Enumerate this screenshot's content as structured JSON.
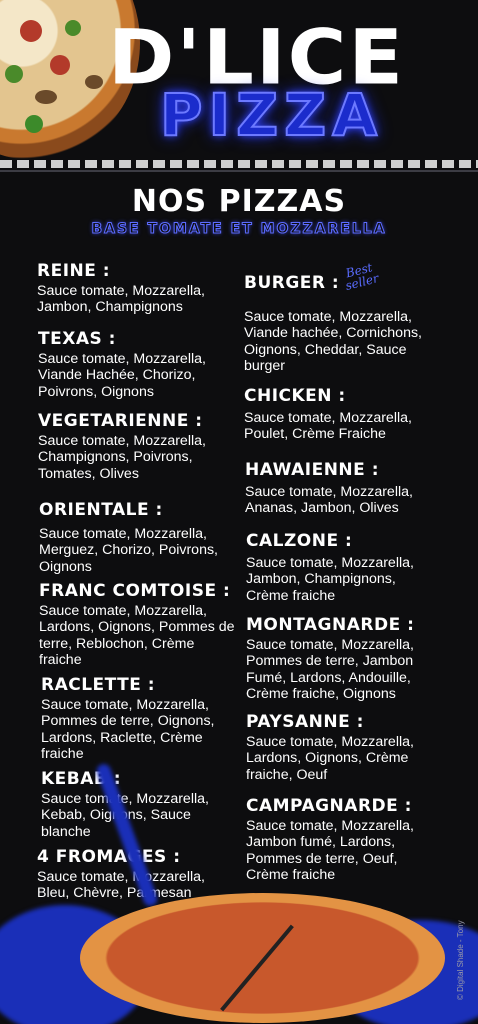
{
  "brand": {
    "name": "D'LICE",
    "subname": "PIZZA"
  },
  "menu": {
    "title": "NOS PIZZAS",
    "subtitle": "BASE TOMATE ET MOZZARELLA",
    "left": [
      {
        "name": "REINE :",
        "desc": "Sauce tomate, Mozzarella, Jambon, Champignons"
      },
      {
        "name": "TEXAS :",
        "desc": "Sauce tomate, Mozzarella, Viande Hachée, Chorizo, Poivrons, Oignons"
      },
      {
        "name": "VEGETARIENNE :",
        "desc": "Sauce tomate, Mozzarella, Champignons, Poivrons, Tomates, Olives"
      },
      {
        "name": "ORIENTALE :",
        "desc": "Sauce tomate, Mozzarella, Merguez, Chorizo, Poivrons, Oignons"
      },
      {
        "name": "FRANC COMTOISE :",
        "desc": "Sauce tomate, Mozzarella, Lardons, Oignons, Pommes de terre, Reblochon, Crème fraiche"
      },
      {
        "name": "RACLETTE :",
        "desc": "Sauce tomate, Mozzarella, Pommes de terre, Oignons, Lardons, Raclette, Crème fraiche"
      },
      {
        "name": "KEBAB :",
        "desc": "Sauce tomate, Mozzarella, Kebab, Oignons, Sauce blanche"
      },
      {
        "name": "4 FROMAGES :",
        "desc": "Sauce tomate, Mozzarella, Bleu, Chèvre, Parmesan"
      }
    ],
    "right": [
      {
        "name": "BURGER :",
        "desc": "Sauce tomate, Mozzarella, Viande hachée, Cornichons, Oignons, Cheddar, Sauce burger"
      },
      {
        "name": "CHICKEN :",
        "desc": "Sauce tomate, Mozzarella, Poulet, Crème Fraiche"
      },
      {
        "name": "HAWAIENNE :",
        "desc": "Sauce tomate, Mozzarella, Ananas, Jambon, Olives"
      },
      {
        "name": "CALZONE :",
        "desc": "Sauce tomate, Mozzarella, Jambon, Champignons, Crème fraiche"
      },
      {
        "name": "MONTAGNARDE :",
        "desc": "Sauce tomate, Mozzarella, Pommes de terre, Jambon Fumé, Lardons, Andouille, Crème fraiche, Oignons"
      },
      {
        "name": "PAYSANNE :",
        "desc": "Sauce tomate, Mozzarella, Lardons, Oignons, Crème fraiche, Oeuf"
      },
      {
        "name": "CAMPAGNARDE :",
        "desc": "Sauce tomate, Mozzarella, Jambon fumé, Lardons, Pommes de terre, Oeuf, Crème fraiche"
      }
    ],
    "badge": {
      "line1": "Best",
      "line2": "seller"
    }
  },
  "copyright": "© Digital Shade - Tony",
  "colors": {
    "background": "#0d0d0f",
    "accent": "#1b2ccc",
    "text": "#ffffff"
  }
}
